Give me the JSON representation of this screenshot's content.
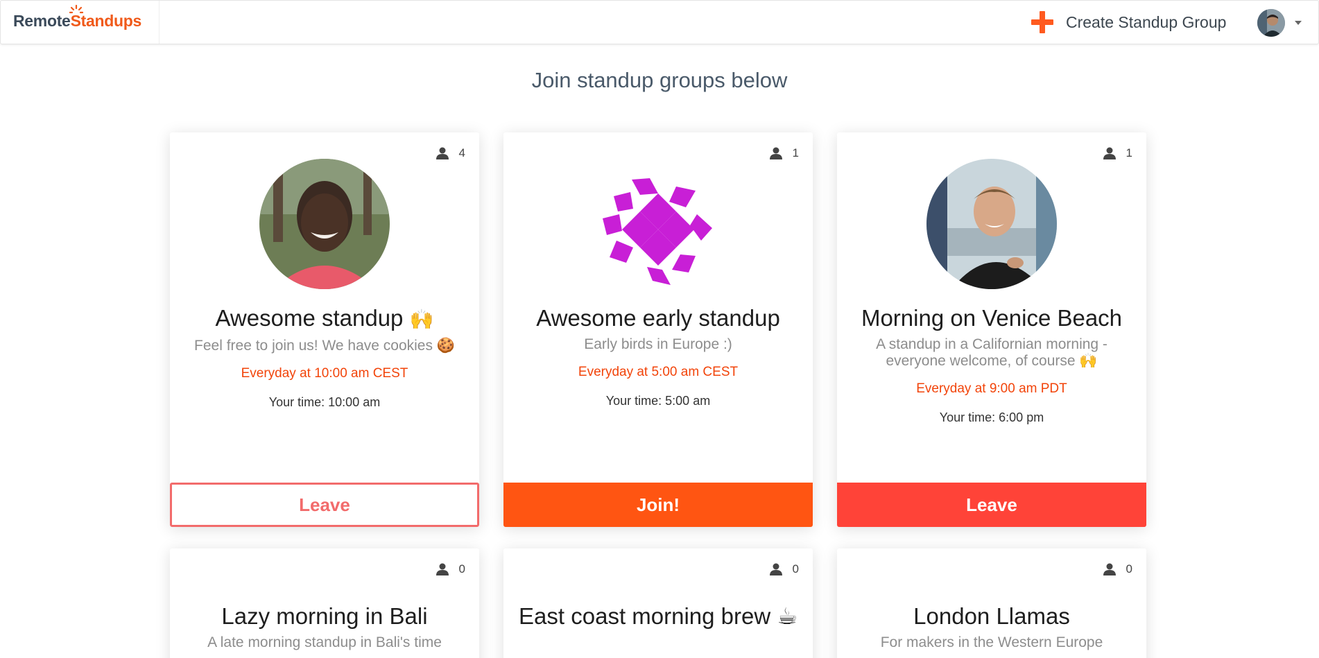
{
  "header": {
    "logo_remote": "Remote",
    "logo_standups": "Standups",
    "create_label": "Create Standup Group"
  },
  "page_title": "Join standup groups below",
  "cards": [
    {
      "members": "4",
      "title": "Awesome standup",
      "title_emoji": "🙌",
      "desc": "Feel free to join us! We have cookies 🍪",
      "schedule": "Everyday at 10:00 am CEST",
      "your_time": "Your time: 10:00 am",
      "button": "Leave"
    },
    {
      "members": "1",
      "title": "Awesome early standup",
      "desc": "Early birds in Europe :)",
      "schedule": "Everyday at 5:00 am CEST",
      "your_time": "Your time: 5:00 am",
      "button": "Join!"
    },
    {
      "members": "1",
      "title": "Morning on Venice Beach",
      "desc": "A standup in a Californian morning - everyone welcome, of course 🙌",
      "schedule": "Everyday at 9:00 am PDT",
      "your_time": "Your time: 6:00 pm",
      "button": "Leave"
    },
    {
      "members": "0",
      "title": "Lazy morning in Bali",
      "desc": "A late morning standup in Bali's time"
    },
    {
      "members": "0",
      "title": "East coast morning brew ☕",
      "desc": ""
    },
    {
      "members": "0",
      "title": "London Llamas",
      "desc": "For makers in the Western Europe"
    }
  ],
  "colors": {
    "brand_orange": "#ff5512",
    "leave_red": "#ff4338",
    "schedule_text": "#f2440a"
  }
}
